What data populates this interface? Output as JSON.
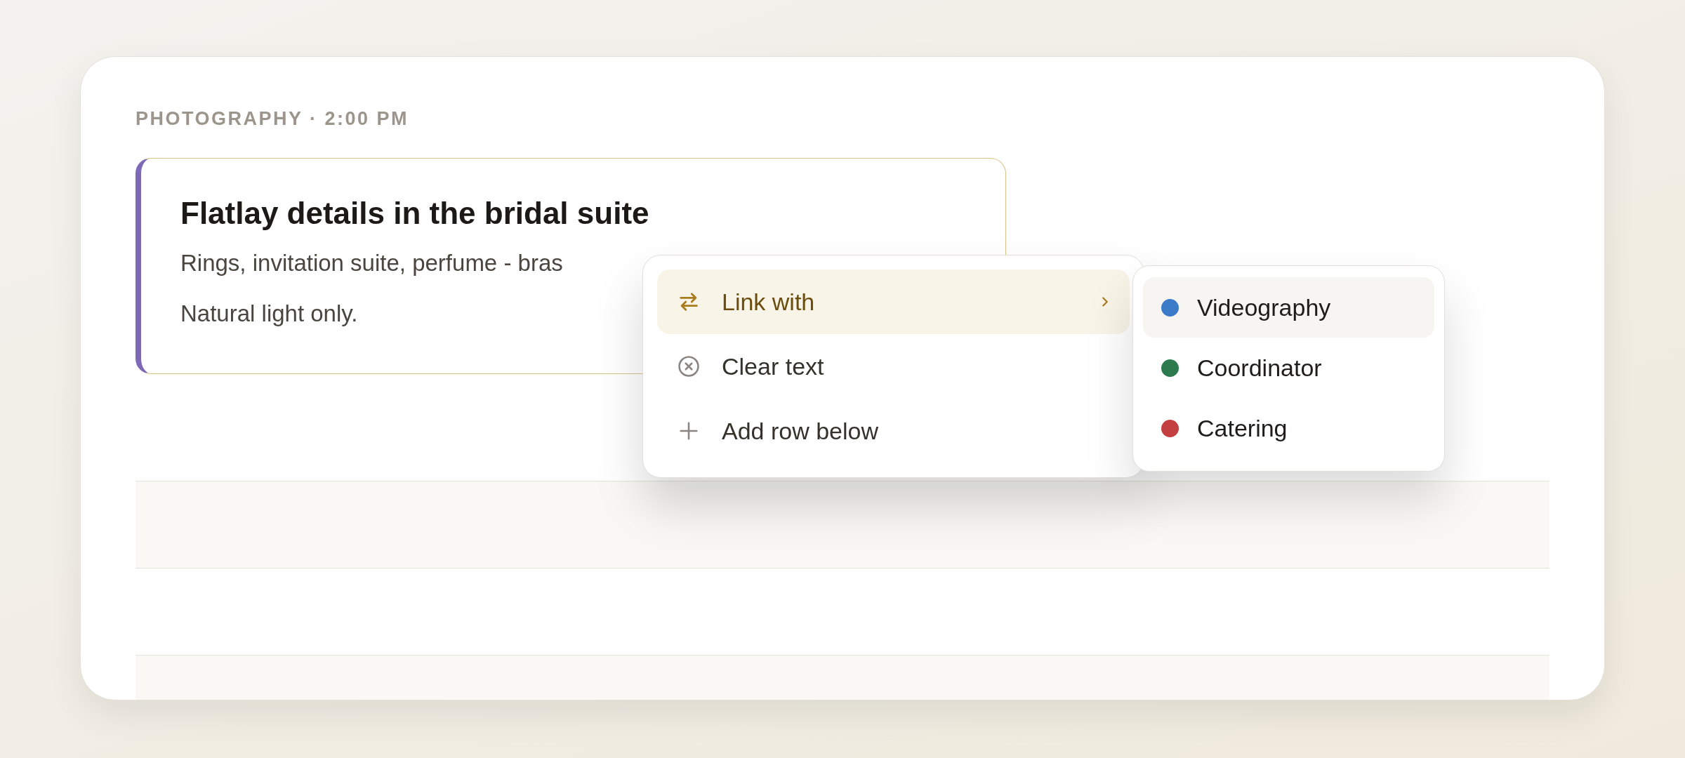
{
  "section_label": "PHOTOGRAPHY · 2:00 PM",
  "note": {
    "title": "Flatlay details in the bridal suite",
    "lines": [
      "Rings, invitation suite, perfume - bras",
      "Natural light only."
    ]
  },
  "context_menu": {
    "items": [
      {
        "kind": "link",
        "label": "Link with",
        "selected": true,
        "has_submenu": true
      },
      {
        "kind": "clear",
        "label": "Clear text",
        "selected": false,
        "has_submenu": false
      },
      {
        "kind": "add",
        "label": "Add row below",
        "selected": false,
        "has_submenu": false
      }
    ]
  },
  "submenu": {
    "items": [
      {
        "label": "Videography",
        "color": "#3b7bc8",
        "selected": true
      },
      {
        "label": "Coordinator",
        "color": "#2e7a4f",
        "selected": false
      },
      {
        "label": "Catering",
        "color": "#c43f3f",
        "selected": false
      }
    ]
  }
}
